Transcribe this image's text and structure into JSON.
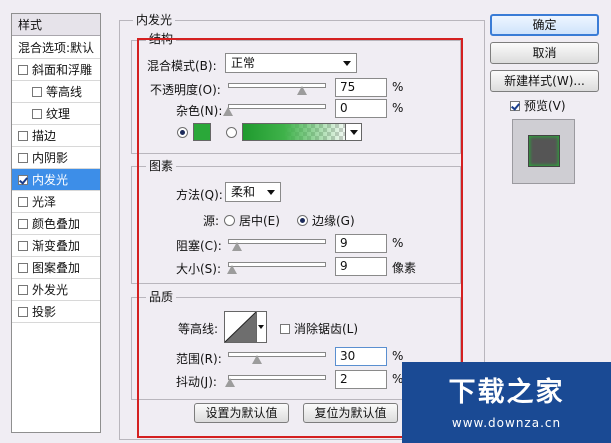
{
  "style_panel": {
    "header": "样式",
    "items": [
      {
        "label": "混合选项:默认",
        "check": false,
        "sub": false,
        "has_check": false,
        "selected": false
      },
      {
        "label": "斜面和浮雕",
        "check": false,
        "sub": false,
        "has_check": true,
        "selected": false
      },
      {
        "label": "等高线",
        "check": false,
        "sub": true,
        "has_check": true,
        "selected": false
      },
      {
        "label": "纹理",
        "check": false,
        "sub": true,
        "has_check": true,
        "selected": false
      },
      {
        "label": "描边",
        "check": false,
        "sub": false,
        "has_check": true,
        "selected": false
      },
      {
        "label": "内阴影",
        "check": false,
        "sub": false,
        "has_check": true,
        "selected": false
      },
      {
        "label": "内发光",
        "check": true,
        "sub": false,
        "has_check": true,
        "selected": true
      },
      {
        "label": "光泽",
        "check": false,
        "sub": false,
        "has_check": true,
        "selected": false
      },
      {
        "label": "颜色叠加",
        "check": false,
        "sub": false,
        "has_check": true,
        "selected": false
      },
      {
        "label": "渐变叠加",
        "check": false,
        "sub": false,
        "has_check": true,
        "selected": false
      },
      {
        "label": "图案叠加",
        "check": false,
        "sub": false,
        "has_check": true,
        "selected": false
      },
      {
        "label": "外发光",
        "check": false,
        "sub": false,
        "has_check": true,
        "selected": false
      },
      {
        "label": "投影",
        "check": false,
        "sub": false,
        "has_check": true,
        "selected": false
      }
    ]
  },
  "inner_glow": {
    "title": "内发光",
    "structure": {
      "title": "结构",
      "blend_mode_label": "混合模式(B):",
      "blend_mode_value": "正常",
      "opacity_label": "不透明度(O):",
      "opacity_value": "75",
      "opacity_unit": "%",
      "opacity_fraction": 0.75,
      "noise_label": "杂色(N):",
      "noise_value": "0",
      "noise_unit": "%",
      "noise_fraction": 0.0,
      "glow_color": "#2aa839"
    },
    "elements": {
      "title": "图素",
      "method_label": "方法(Q):",
      "method_value": "柔和",
      "source_label": "源:",
      "source_center": "居中(E)",
      "source_edge": "边缘(G)",
      "choke_label": "阻塞(C):",
      "choke_value": "9",
      "choke_unit": "%",
      "choke_fraction": 0.09,
      "size_label": "大小(S):",
      "size_value": "9",
      "size_unit": "像素",
      "size_fraction": 0.036
    },
    "quality": {
      "title": "品质",
      "contour_label": "等高线:",
      "anti_alias_label": "消除锯齿(L)",
      "range_label": "范围(R):",
      "range_value": "30",
      "range_unit": "%",
      "range_fraction": 0.3,
      "jitter_label": "抖动(J):",
      "jitter_value": "2",
      "jitter_unit": "%",
      "jitter_fraction": 0.02
    },
    "set_default_button": "设置为默认值",
    "reset_default_button": "复位为默认值"
  },
  "actions": {
    "ok": "确定",
    "cancel": "取消",
    "new_style": "新建样式(W)...",
    "preview_label": "预览(V)"
  },
  "watermark": {
    "text": "下载之家",
    "url": "www.downza.cn"
  }
}
